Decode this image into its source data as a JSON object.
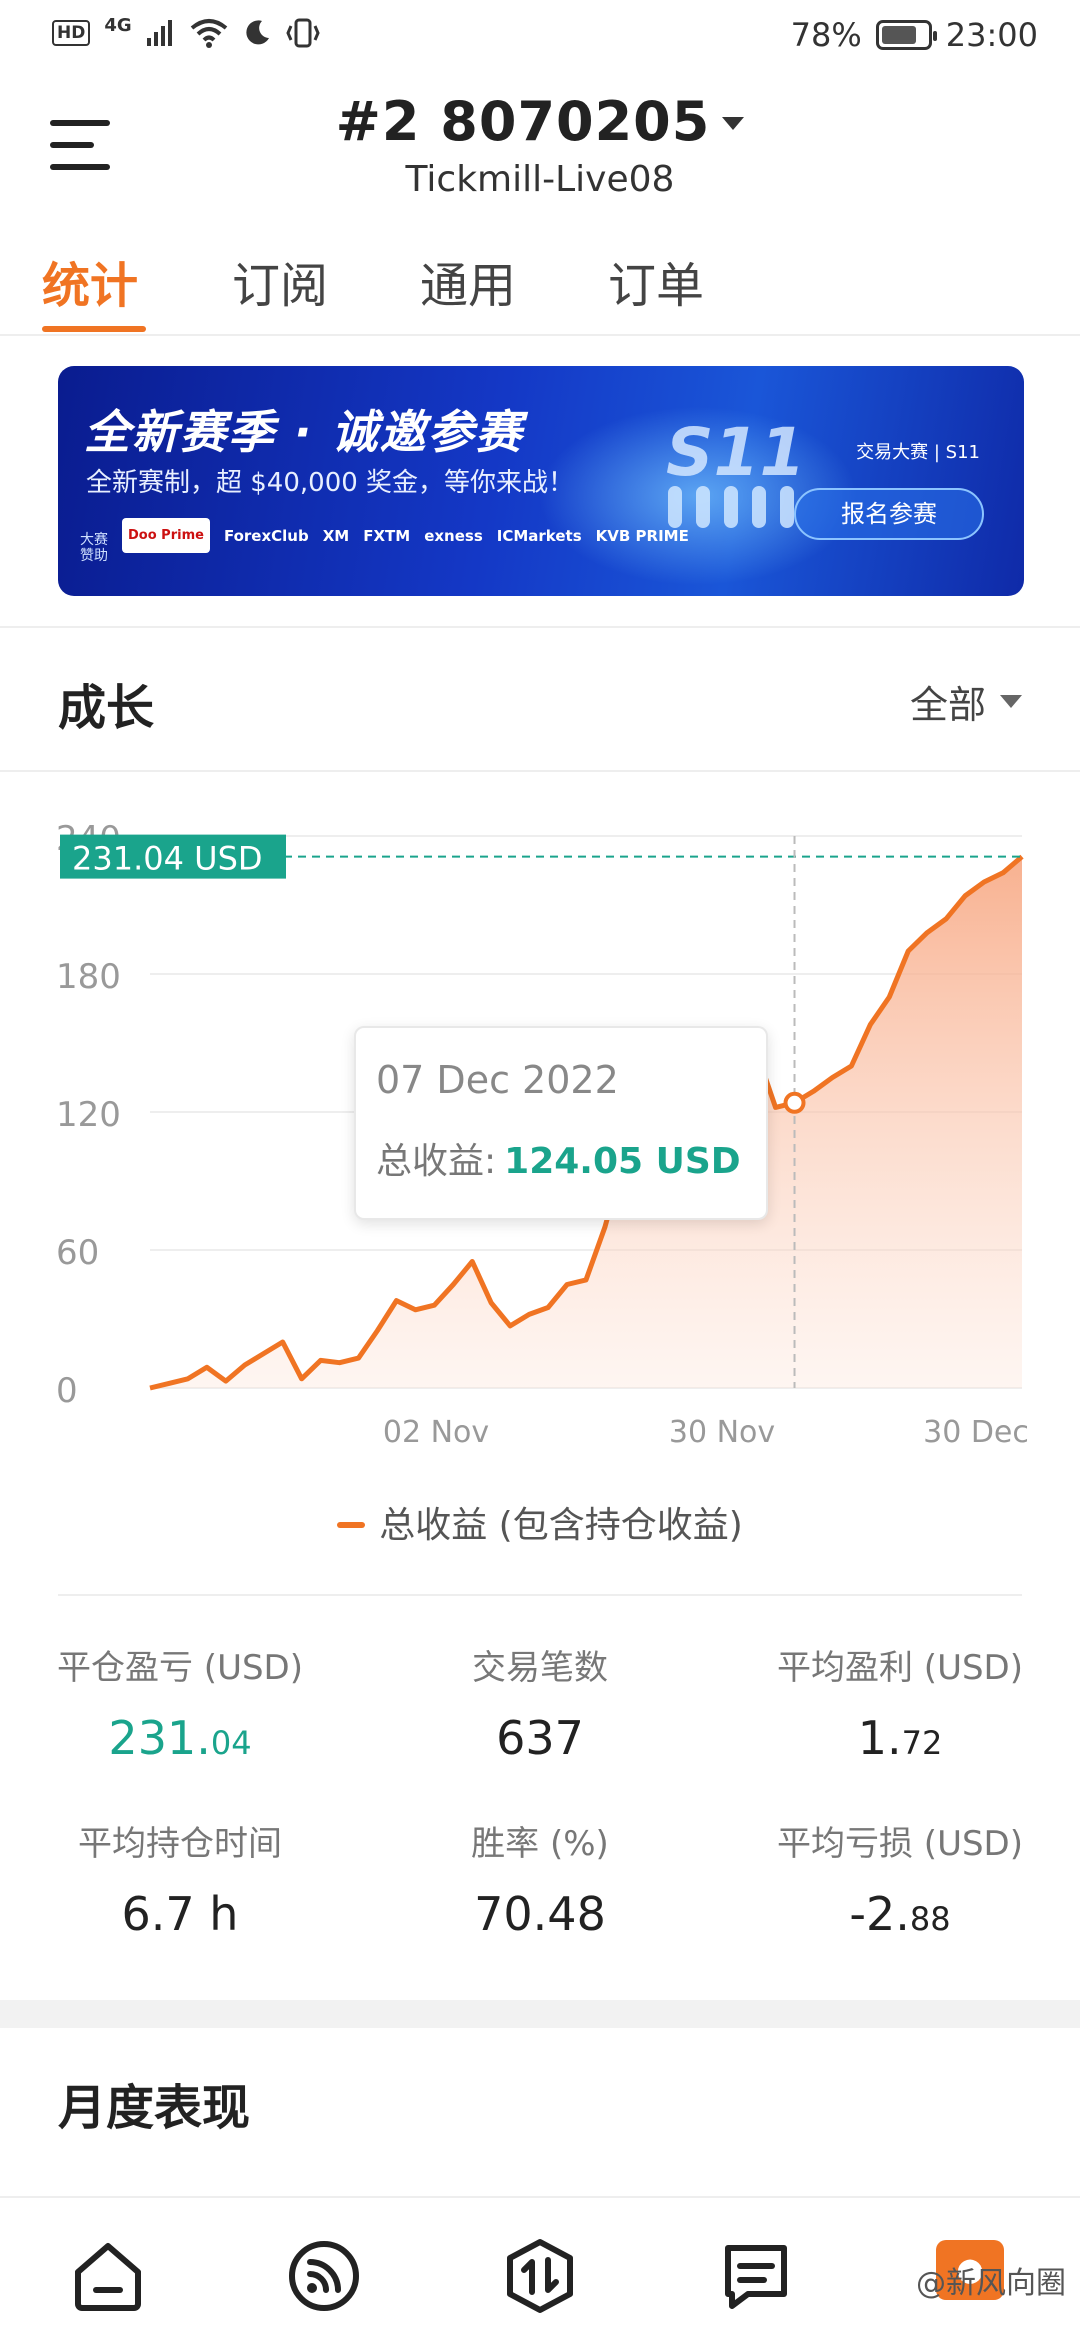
{
  "status_bar": {
    "hd": "HD",
    "network": "4G",
    "battery": "78%",
    "battery_level": 0.78,
    "time": "23:00"
  },
  "header": {
    "account_number": "#2 8070205",
    "server": "Tickmill-Live08"
  },
  "tabs": [
    {
      "label": "统计",
      "active": true
    },
    {
      "label": "订阅",
      "active": false
    },
    {
      "label": "通用",
      "active": false
    },
    {
      "label": "订单",
      "active": false
    }
  ],
  "banner": {
    "title": "全新赛季 · 诚邀参赛",
    "subtitle": "全新赛制，超 $40,000 奖金，等你来战！",
    "season": "S11",
    "brand": "交易大赛 | S11",
    "button": "报名参赛",
    "sponsor_label": "大赛赞助",
    "sponsors": [
      "Doo Prime",
      "ForexClub",
      "XM",
      "FXTM",
      "exness",
      "ICMarkets",
      "KVB PRIME"
    ]
  },
  "growth": {
    "title": "成长",
    "filter": "全部"
  },
  "chart_data": {
    "type": "area",
    "y_ticks": [
      "0",
      "60",
      "120",
      "180",
      "240"
    ],
    "ylim": [
      0,
      240
    ],
    "x_ticks": [
      "02 Nov",
      "30 Nov",
      "30 Dec"
    ],
    "current_label": "231.04 USD",
    "tooltip": {
      "date": "07 Dec 2022",
      "label": "总收益:",
      "value": "124.05 USD"
    },
    "legend": "总收益 (包含持仓收益)",
    "series": [
      {
        "name": "总收益 (包含持仓收益)",
        "color": "#f07423",
        "values": [
          0,
          2,
          4,
          9,
          3,
          10,
          15,
          20,
          4,
          12,
          11,
          13,
          25,
          38,
          34,
          36,
          45,
          55,
          37,
          27,
          32,
          35,
          45,
          47,
          70,
          100,
          118,
          125,
          130,
          128,
          132,
          138,
          146,
          122,
          124,
          129,
          135,
          140,
          158,
          170,
          190,
          198,
          204,
          214,
          220,
          224,
          231.04
        ]
      }
    ]
  },
  "stats": [
    {
      "label": "平仓盈亏 (USD)",
      "int": "231.",
      "dec": "04",
      "green": true
    },
    {
      "label": "交易笔数",
      "int": "637",
      "dec": "",
      "green": false
    },
    {
      "label": "平均盈利 (USD)",
      "int": "1.",
      "dec": "72",
      "green": false
    },
    {
      "label": "平均持仓时间",
      "int": "6.7 h",
      "dec": "",
      "green": false
    },
    {
      "label": "胜率 (%)",
      "int": "70.48",
      "dec": "",
      "green": false
    },
    {
      "label": "平均亏损 (USD)",
      "int": "-2.",
      "dec": "88",
      "green": false
    }
  ],
  "monthly": {
    "title": "月度表现"
  },
  "bottom_nav": {
    "items": [
      "home-icon",
      "signal-icon",
      "trade-icon",
      "message-icon",
      "profile-icon"
    ],
    "watermark": "@新风向圈"
  },
  "colors": {
    "accent": "#f07423",
    "green": "#1aa48c"
  }
}
